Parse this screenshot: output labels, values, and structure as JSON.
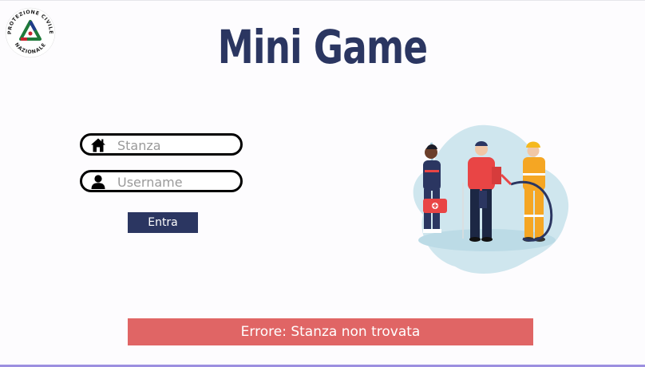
{
  "logo": {
    "top_text": "PROTEZIONE CIVILE",
    "bottom_text": "NAZIONALE"
  },
  "title": "Mini Game",
  "form": {
    "room_placeholder": "Stanza",
    "room_icon": "home-icon",
    "username_placeholder": "Username",
    "username_icon": "user-icon",
    "submit_label": "Entra"
  },
  "error_message": "Errore: Stanza non trovata",
  "colors": {
    "brand": "#2b3661",
    "error": "#e06565",
    "illustration_bg": "#cfe6ee"
  }
}
